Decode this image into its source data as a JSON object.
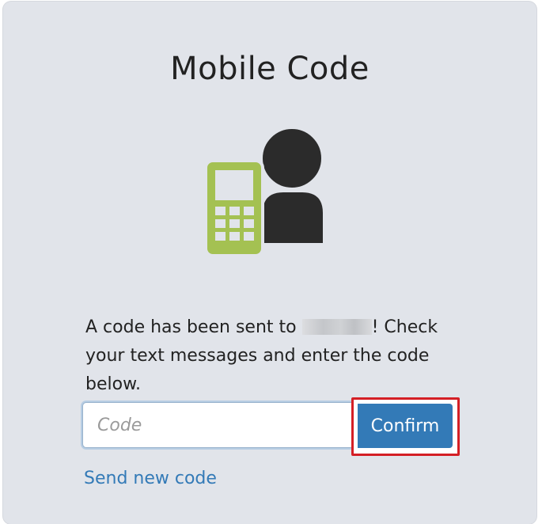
{
  "card": {
    "title": "Mobile Code",
    "illustration_icon": "mobile-phone-user-icon",
    "message_prefix": "A code has been sent to ",
    "message_suffix": "! Check your text messages and enter the code below."
  },
  "form": {
    "code_placeholder": "Code",
    "code_value": "",
    "confirm_label": "Confirm",
    "send_new_code_label": "Send new code"
  },
  "colors": {
    "card_background": "#e1e4ea",
    "phone_green": "#a4c152",
    "person_dark": "#2b2b2b",
    "primary_blue": "#337ab7",
    "highlight_red": "#d41f26"
  }
}
